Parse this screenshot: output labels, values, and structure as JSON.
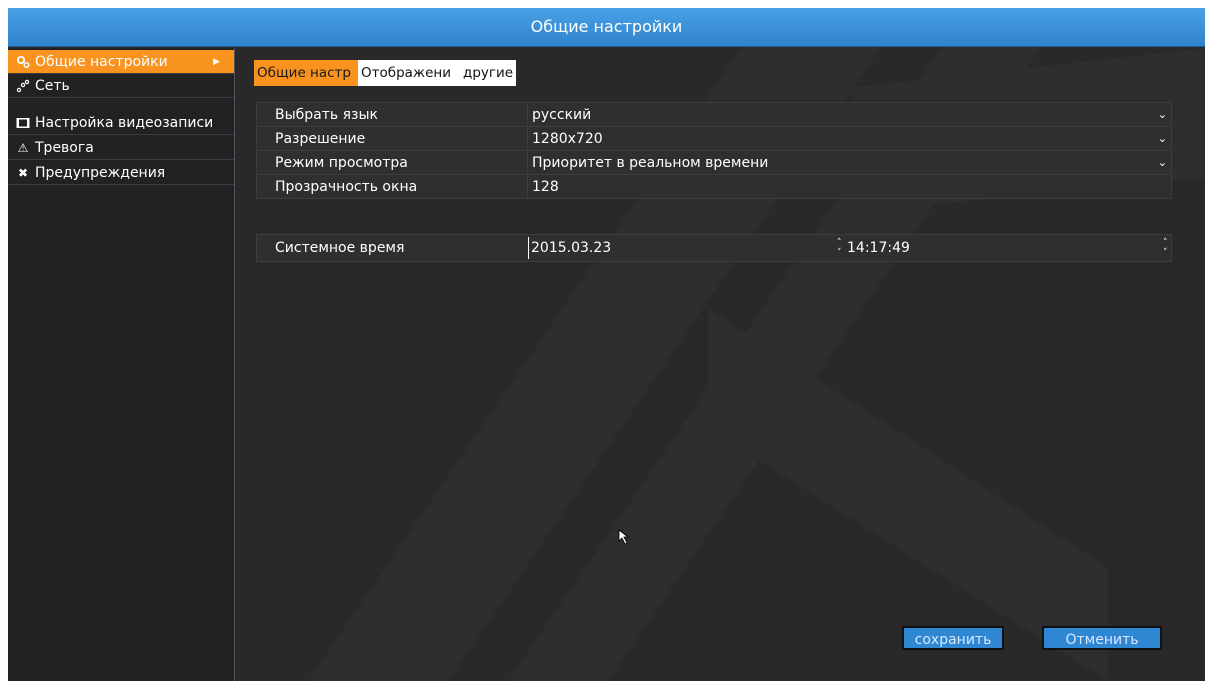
{
  "window": {
    "title": "Общие настройки"
  },
  "sidebar": {
    "items": [
      {
        "label": "Общие настройки",
        "icon": "gears-icon",
        "active": true
      },
      {
        "label": "Сеть",
        "icon": "network-icon",
        "active": false
      },
      {
        "label": "Настройка видеозаписи",
        "icon": "film-icon",
        "active": false
      },
      {
        "label": "Тревога",
        "icon": "warning-icon",
        "active": false
      },
      {
        "label": "Предупреждения",
        "icon": "tools-icon",
        "active": false
      }
    ]
  },
  "tabs": [
    {
      "label": "Общие настр",
      "active": true
    },
    {
      "label": "Отображени",
      "active": false
    },
    {
      "label": "другие настр",
      "active": false
    }
  ],
  "settings": [
    {
      "label": "Выбрать язык",
      "value": "русский",
      "dropdown": true
    },
    {
      "label": "Разрешение",
      "value": "1280x720",
      "dropdown": true
    },
    {
      "label": "Режим просмотра",
      "value": "Приоритет в реальном времени",
      "dropdown": true
    },
    {
      "label": "Прозрачность окна",
      "value": "128",
      "dropdown": false
    }
  ],
  "system_time": {
    "label": "Системное время",
    "date": "2015.03.23",
    "time": "14:17:49"
  },
  "buttons": {
    "save": "сохранить",
    "cancel": "Отменить"
  },
  "colors": {
    "accent": "#f7931e",
    "titlebar": "#3a92da",
    "button": "#2f86d3",
    "background": "#29292b"
  }
}
